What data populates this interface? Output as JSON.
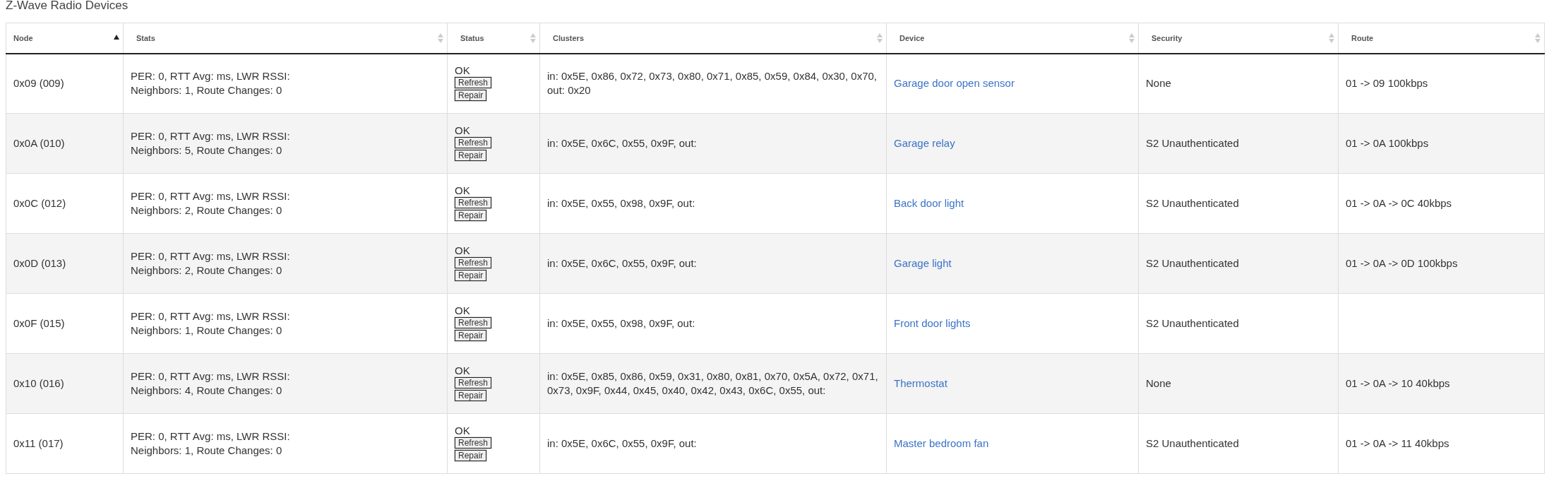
{
  "title": "Z-Wave Radio Devices",
  "table": {
    "columns": [
      {
        "label": "Node",
        "sorted": true
      },
      {
        "label": "Stats",
        "sorted": false
      },
      {
        "label": "Status",
        "sorted": false
      },
      {
        "label": "Clusters",
        "sorted": false
      },
      {
        "label": "Device",
        "sorted": false
      },
      {
        "label": "Security",
        "sorted": false
      },
      {
        "label": "Route",
        "sorted": false
      }
    ],
    "rows": [
      {
        "node": "0x09 (009)",
        "stats": [
          "PER: 0, RTT Avg: ms, LWR RSSI:",
          "Neighbors: 1, Route Changes: 0"
        ],
        "status": "OK",
        "buttons": [
          "Refresh",
          "Repair"
        ],
        "clusters": "in: 0x5E, 0x86, 0x72, 0x73, 0x80, 0x71, 0x85, 0x59, 0x84, 0x30, 0x70, out: 0x20",
        "device": "Garage door open sensor",
        "security": "None",
        "route": "01 -> 09 100kbps"
      },
      {
        "node": "0x0A (010)",
        "stats": [
          "PER: 0, RTT Avg: ms, LWR RSSI:",
          "Neighbors: 5, Route Changes: 0"
        ],
        "status": "OK",
        "buttons": [
          "Refresh",
          "Repair"
        ],
        "clusters": "in: 0x5E, 0x6C, 0x55, 0x9F, out:",
        "device": "Garage relay",
        "security": "S2 Unauthenticated",
        "route": "01 -> 0A 100kbps"
      },
      {
        "node": "0x0C (012)",
        "stats": [
          "PER: 0, RTT Avg: ms, LWR RSSI:",
          "Neighbors: 2, Route Changes: 0"
        ],
        "status": "OK",
        "buttons": [
          "Refresh",
          "Repair"
        ],
        "clusters": "in: 0x5E, 0x55, 0x98, 0x9F, out:",
        "device": "Back door light",
        "security": "S2 Unauthenticated",
        "route": "01 -> 0A -> 0C 40kbps"
      },
      {
        "node": "0x0D (013)",
        "stats": [
          "PER: 0, RTT Avg: ms, LWR RSSI:",
          "Neighbors: 2, Route Changes: 0"
        ],
        "status": "OK",
        "buttons": [
          "Refresh",
          "Repair"
        ],
        "clusters": "in: 0x5E, 0x6C, 0x55, 0x9F, out:",
        "device": "Garage light",
        "security": "S2 Unauthenticated",
        "route": "01 -> 0A -> 0D 100kbps"
      },
      {
        "node": "0x0F (015)",
        "stats": [
          "PER: 0, RTT Avg: ms, LWR RSSI:",
          "Neighbors: 1, Route Changes: 0"
        ],
        "status": "OK",
        "buttons": [
          "Refresh",
          "Repair"
        ],
        "clusters": "in: 0x5E, 0x55, 0x98, 0x9F, out:",
        "device": "Front door lights",
        "security": "S2 Unauthenticated"
      },
      {
        "node": "0x10 (016)",
        "stats": [
          "PER: 0, RTT Avg: ms, LWR RSSI:",
          "Neighbors: 4, Route Changes: 0"
        ],
        "status": "OK",
        "buttons": [
          "Refresh",
          "Repair"
        ],
        "clusters": "in: 0x5E, 0x85, 0x86, 0x59, 0x31, 0x80, 0x81, 0x70, 0x5A, 0x72, 0x71, 0x73, 0x9F, 0x44, 0x45, 0x40, 0x42, 0x43, 0x6C, 0x55, out:",
        "device": "Thermostat",
        "security": "None",
        "route": "01 -> 0A -> 10 40kbps"
      },
      {
        "node": "0x11 (017)",
        "stats": [
          "PER: 0, RTT Avg: ms, LWR RSSI:",
          "Neighbors: 1, Route Changes: 0"
        ],
        "status": "OK",
        "buttons": [
          "Refresh",
          "Repair"
        ],
        "clusters": "in: 0x5E, 0x6C, 0x55, 0x9F, out:",
        "device": "Master bedroom fan",
        "security": "S2 Unauthenticated",
        "route": "01 -> 0A -> 11 40kbps"
      }
    ]
  }
}
